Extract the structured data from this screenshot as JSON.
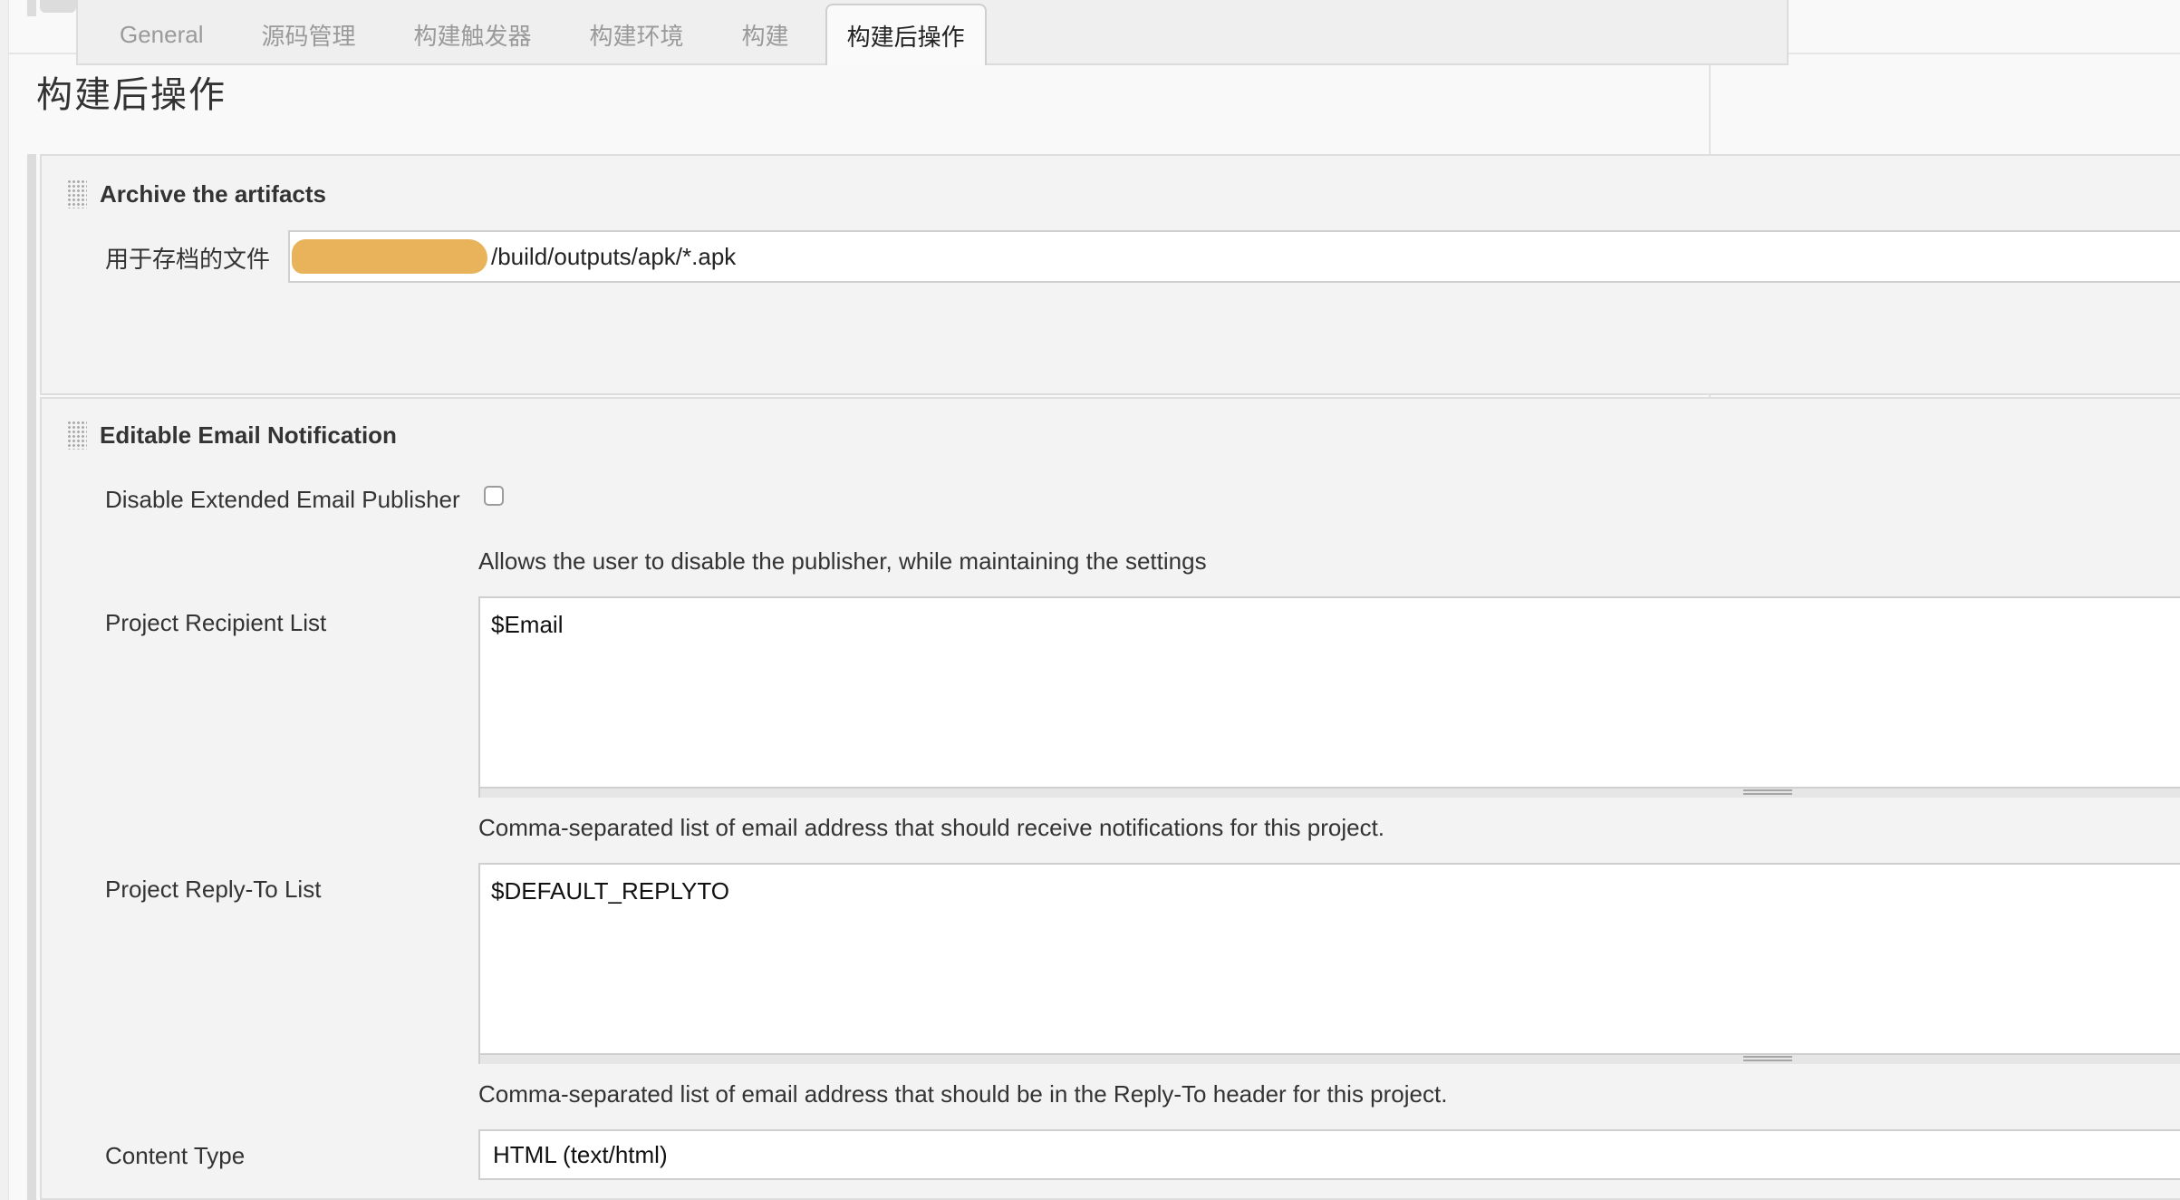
{
  "tabs": [
    {
      "label": "General",
      "active": false
    },
    {
      "label": "源码管理",
      "active": false
    },
    {
      "label": "构建触发器",
      "active": false
    },
    {
      "label": "构建环境",
      "active": false
    },
    {
      "label": "构建",
      "active": false
    },
    {
      "label": "构建后操作",
      "active": true
    }
  ],
  "page_title": "构建后操作",
  "archive": {
    "title": "Archive the artifacts",
    "files_label": "用于存档的文件",
    "files_value_visible": "/build/outputs/apk/*.apk"
  },
  "email": {
    "title": "Editable Email Notification",
    "disable_label": "Disable Extended Email Publisher",
    "disable_checked": false,
    "disable_help": "Allows the user to disable the publisher, while maintaining the settings",
    "recipient_label": "Project Recipient List",
    "recipient_value": "$Email",
    "recipient_help": "Comma-separated list of email address that should receive notifications for this project.",
    "replyto_label": "Project Reply-To List",
    "replyto_value": "$DEFAULT_REPLYTO",
    "replyto_help": "Comma-separated list of email address that should be in the Reply-To header for this project.",
    "content_type_label": "Content Type",
    "content_type_value": "HTML (text/html)"
  },
  "colors": {
    "redaction": "#e8b35a",
    "background": "#f9f9f9",
    "section_bg": "#f3f3f3"
  }
}
